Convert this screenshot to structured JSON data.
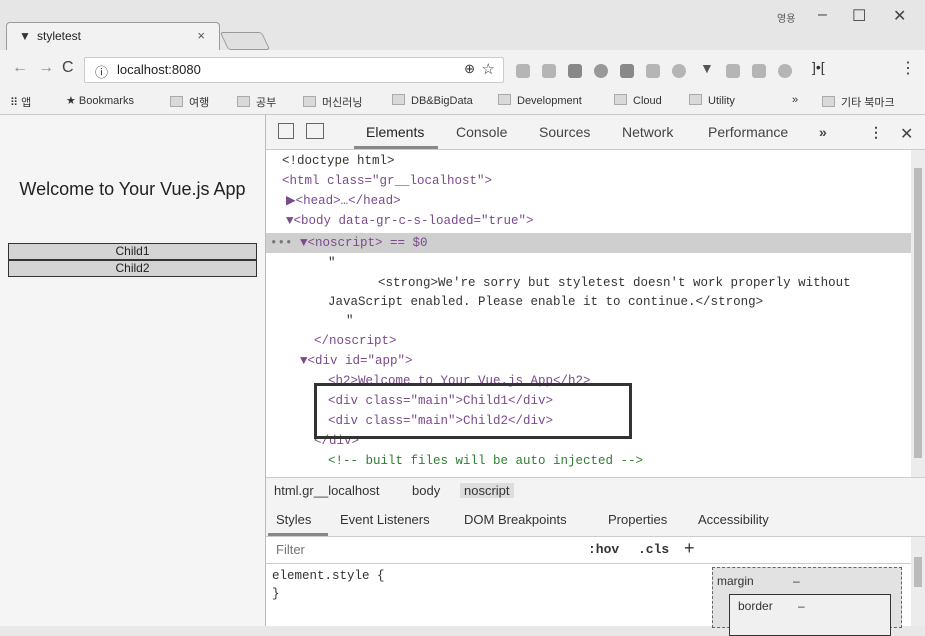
{
  "browser": {
    "tab_title": "styletest",
    "tab_close": "×",
    "profile_label": "영용",
    "url": "localhost:8080",
    "bookmarks": [
      {
        "label": "앱",
        "icon": "apps-icon"
      },
      {
        "label": "Bookmarks",
        "icon": "star-icon"
      },
      {
        "label": "여행",
        "icon": "folder-icon"
      },
      {
        "label": "공부",
        "icon": "folder-icon"
      },
      {
        "label": "머신러닝",
        "icon": "folder-icon"
      },
      {
        "label": "DB&BigData",
        "icon": "folder-icon"
      },
      {
        "label": "Development",
        "icon": "folder-icon"
      },
      {
        "label": "Cloud",
        "icon": "folder-icon"
      },
      {
        "label": "Utility",
        "icon": "folder-icon"
      },
      {
        "label": "»",
        "icon": ""
      },
      {
        "label": "기타 북마크",
        "icon": "folder-icon"
      }
    ]
  },
  "page": {
    "title": "Welcome to Your Vue.js App",
    "children": [
      "Child1",
      "Child2"
    ]
  },
  "devtools": {
    "tabs": [
      "Elements",
      "Console",
      "Sources",
      "Network",
      "Performance",
      "»"
    ],
    "dom_lines": [
      "<!doctype html>",
      "<html class=\"gr__localhost\">",
      "▶<head>…</head>",
      "▼<body data-gr-c-s-loaded=\"true\">",
      "▼<noscript> == $0",
      "\"",
      "<strong>We're sorry but styletest doesn't work properly without",
      "JavaScript enabled. Please enable it to continue.</strong>",
      "\"",
      "</noscript>",
      "▼<div id=\"app\">",
      "<h2>Welcome to Your Vue.js App</h2>",
      "<div class=\"main\">Child1</div>",
      "<div class=\"main\">Child2</div>",
      "</div>",
      "<!-- built files will be auto injected -->"
    ],
    "breadcrumbs": [
      "html.gr__localhost",
      "body",
      "noscript"
    ],
    "subtabs": [
      "Styles",
      "Event Listeners",
      "DOM Breakpoints",
      "Properties",
      "Accessibility"
    ],
    "filter_placeholder": "Filter",
    "hov": ":hov",
    "cls": ".cls",
    "plus": "+",
    "styles_code": "element.style {\n}",
    "box_margin": "margin",
    "box_border": "border",
    "box_dash": "–"
  }
}
